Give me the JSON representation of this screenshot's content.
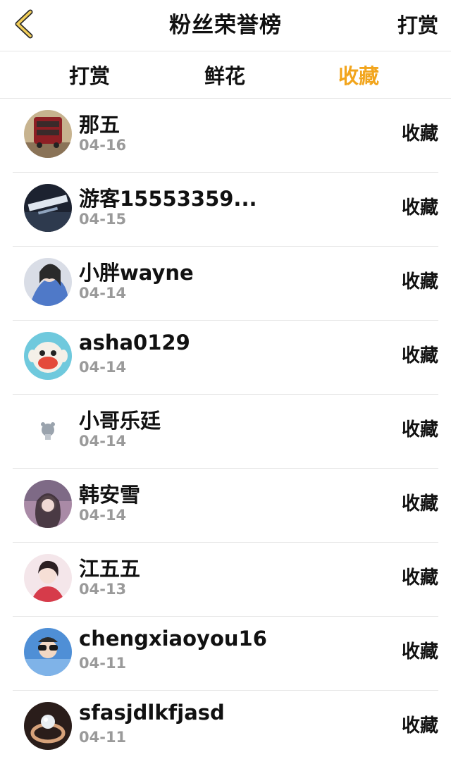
{
  "header": {
    "title": "粉丝荣誉榜",
    "action_label": "打赏",
    "back_icon": "chevron-left-icon",
    "accent": "#f2a51d"
  },
  "tabs": [
    {
      "label": "打赏",
      "active": false
    },
    {
      "label": "鲜花",
      "active": false
    },
    {
      "label": "收藏",
      "active": true
    }
  ],
  "rows": [
    {
      "name": "那五",
      "date": "04-16",
      "action": "收藏"
    },
    {
      "name": "游客15553359...",
      "date": "04-15",
      "action": "收藏"
    },
    {
      "name": "小胖wayne",
      "date": "04-14",
      "action": "收藏"
    },
    {
      "name": "asha0129",
      "date": "04-14",
      "action": "收藏"
    },
    {
      "name": "小哥乐廷",
      "date": "04-14",
      "action": "收藏"
    },
    {
      "name": "韩安雪",
      "date": "04-14",
      "action": "收藏"
    },
    {
      "name": "江五五",
      "date": "04-13",
      "action": "收藏"
    },
    {
      "name": "chengxiaoyou16",
      "date": "04-11",
      "action": "收藏"
    },
    {
      "name": "sfasjdlkfjasd",
      "date": "04-11",
      "action": "收藏"
    }
  ]
}
